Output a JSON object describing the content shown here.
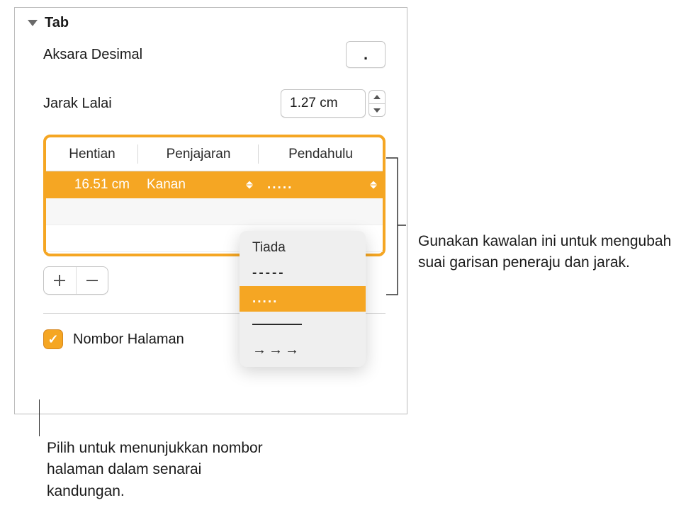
{
  "section": {
    "title": "Tab"
  },
  "decimal": {
    "label": "Aksara Desimal",
    "value": "."
  },
  "spacing": {
    "label": "Jarak Lalai",
    "value": "1.27 cm"
  },
  "table": {
    "headers": {
      "stops": "Hentian",
      "align": "Penjajaran",
      "leader": "Pendahulu"
    },
    "row": {
      "stop": "16.51 cm",
      "align": "Kanan",
      "leader": "....."
    }
  },
  "dropdown": {
    "none": "Tiada",
    "dashes": "-----",
    "dots": ".....",
    "arrows": "→→→"
  },
  "checkbox": {
    "label": "Nombor Halaman"
  },
  "callouts": {
    "right": "Gunakan kawalan ini untuk mengubah suai garisan peneraju dan jarak.",
    "bottom": "Pilih untuk menunjukkan nombor halaman dalam senarai kandungan."
  }
}
